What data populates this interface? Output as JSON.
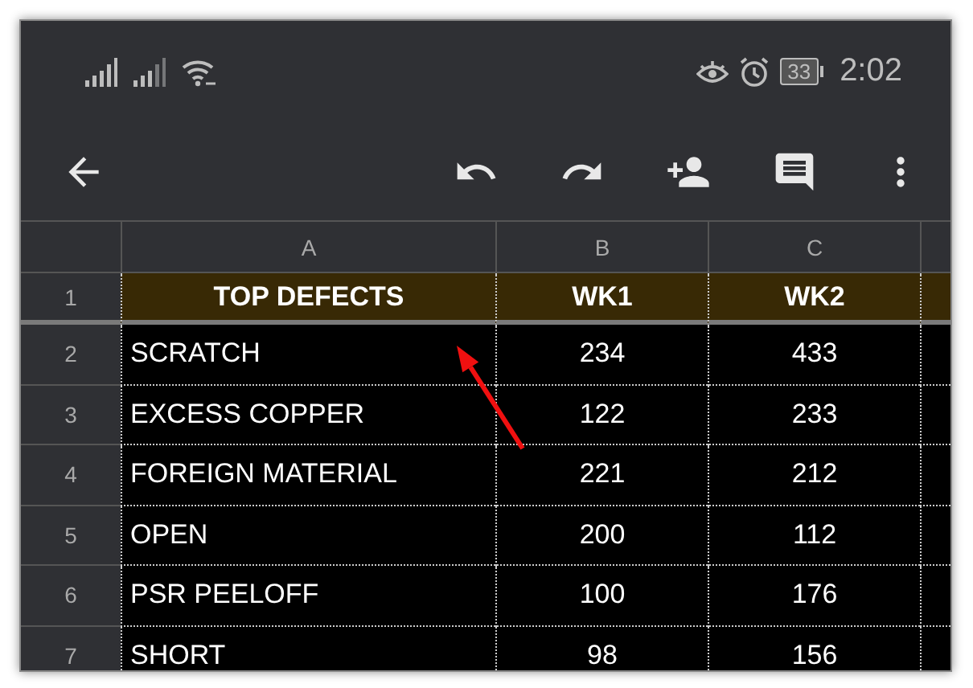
{
  "status_bar": {
    "battery": "33",
    "time": "2:02"
  },
  "sheet": {
    "columns": [
      "A",
      "B",
      "C"
    ],
    "rows": [
      {
        "number": "1",
        "kind": "header",
        "cells": [
          "TOP DEFECTS",
          "WK1",
          "WK2"
        ]
      },
      {
        "number": "2",
        "kind": "data",
        "cells": [
          "SCRATCH",
          "234",
          "433"
        ]
      },
      {
        "number": "3",
        "kind": "data",
        "cells": [
          "EXCESS COPPER",
          "122",
          "233"
        ]
      },
      {
        "number": "4",
        "kind": "data",
        "cells": [
          "FOREIGN MATERIAL",
          "221",
          "212"
        ]
      },
      {
        "number": "5",
        "kind": "data",
        "cells": [
          "OPEN",
          "200",
          "112"
        ]
      },
      {
        "number": "6",
        "kind": "data",
        "cells": [
          "PSR PEELOFF",
          "100",
          "176"
        ]
      },
      {
        "number": "7",
        "kind": "data",
        "cells": [
          "SHORT",
          "98",
          "156"
        ]
      }
    ]
  }
}
